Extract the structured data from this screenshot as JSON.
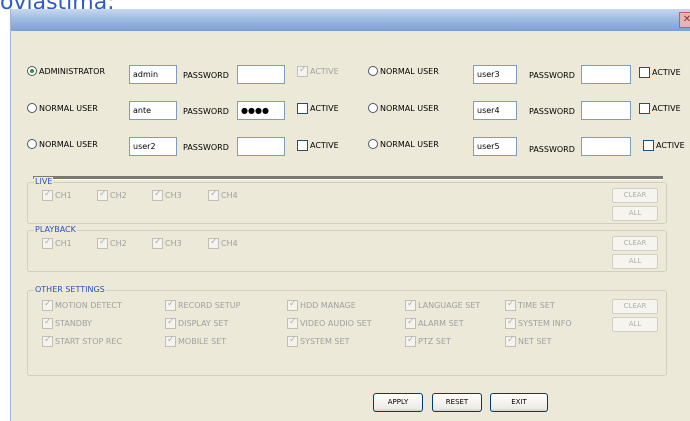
{
  "page_heading": "ovlastima:",
  "users": {
    "password_label": "PASSWORD",
    "active_label": "ACTIVE",
    "left": [
      {
        "role": "ADMINISTRATOR",
        "username": "admin",
        "password": ""
      },
      {
        "role": "NORMAL USER",
        "username": "ante",
        "password": "●●●●"
      },
      {
        "role": "NORMAL USER",
        "username": "user2",
        "password": ""
      }
    ],
    "right": [
      {
        "role": "NORMAL USER",
        "username": "user3",
        "password": ""
      },
      {
        "role": "NORMAL USER",
        "username": "user4",
        "password": ""
      },
      {
        "role": "NORMAL USER",
        "username": "user5",
        "password": ""
      }
    ]
  },
  "live": {
    "title": "LIVE",
    "channels": [
      "CH1",
      "CH2",
      "CH3",
      "CH4"
    ],
    "clear": "CLEAR",
    "all": "ALL"
  },
  "playback": {
    "title": "PLAYBACK",
    "channels": [
      "CH1",
      "CH2",
      "CH3",
      "CH4"
    ],
    "clear": "CLEAR",
    "all": "ALL"
  },
  "other": {
    "title": "OTHER SETTINGS",
    "items": [
      "MOTION DETECT",
      "RECORD SETUP",
      "HDD MANAGE",
      "LANGUAGE SET",
      "TIME SET",
      "STANDBY",
      "DISPLAY SET",
      "VIDEO AUDIO SET",
      "ALARM SET",
      "SYSTEM INFO",
      "START STOP REC",
      "MOBILE SET",
      "SYSTEM SET",
      "PTZ SET",
      "NET SET"
    ],
    "clear": "CLEAR",
    "all": "ALL"
  },
  "footer": {
    "apply": "APPLY",
    "reset": "RESET",
    "exit": "EXIT"
  }
}
